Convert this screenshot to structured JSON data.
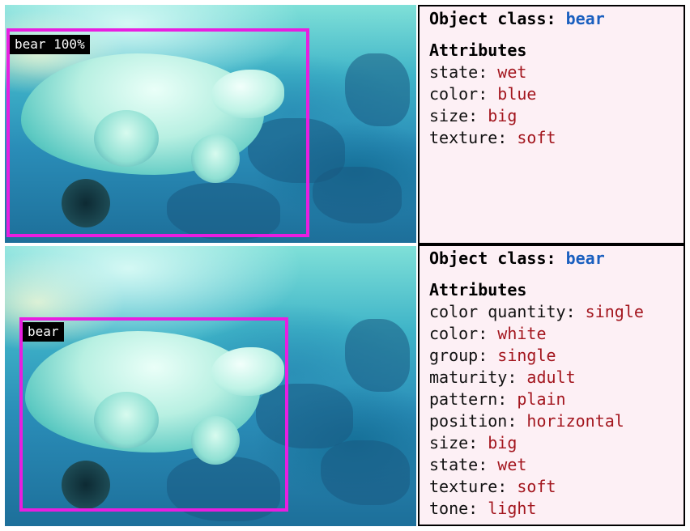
{
  "top": {
    "box_label": "bear 100%",
    "object_class_label": "Object class:",
    "object_class_value": "bear",
    "attributes_heading": "Attributes",
    "attributes": [
      {
        "key": "state:",
        "value": "wet"
      },
      {
        "key": "color:",
        "value": "blue"
      },
      {
        "key": "size:",
        "value": "big"
      },
      {
        "key": "texture:",
        "value": "soft"
      }
    ]
  },
  "bottom": {
    "box_label": "bear",
    "object_class_label": "Object class:",
    "object_class_value": "bear",
    "attributes_heading": "Attributes",
    "attributes": [
      {
        "key": "color quantity:",
        "value": "single"
      },
      {
        "key": "color:",
        "value": "white"
      },
      {
        "key": "group:",
        "value": "single"
      },
      {
        "key": "maturity:",
        "value": "adult"
      },
      {
        "key": "pattern:",
        "value": "plain"
      },
      {
        "key": "position:",
        "value": "horizontal"
      },
      {
        "key": "size:",
        "value": "big"
      },
      {
        "key": "state:",
        "value": "wet"
      },
      {
        "key": "texture:",
        "value": "soft"
      },
      {
        "key": "tone:",
        "value": "light"
      }
    ]
  },
  "colors": {
    "box_border": "#e81ee0",
    "class_value": "#1a5fbf",
    "attribute_value": "#a3161e",
    "panel_background": "#fdf0f5"
  }
}
